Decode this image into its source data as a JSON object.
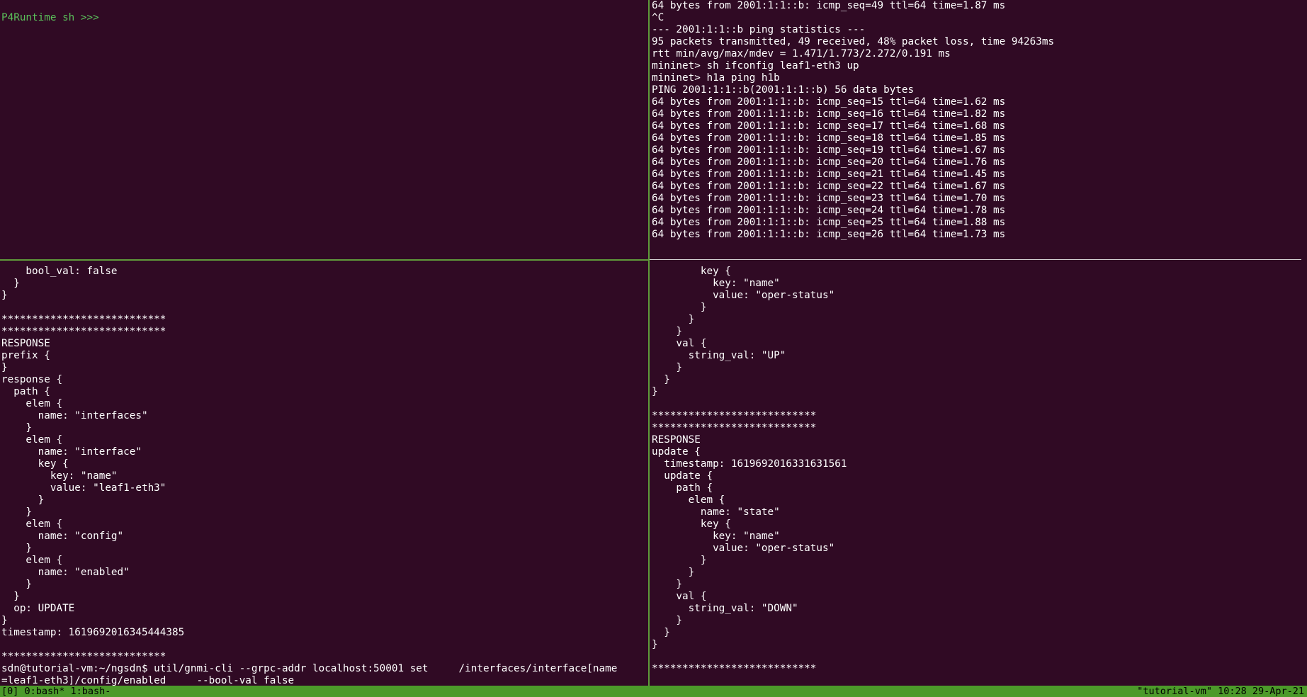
{
  "panes": {
    "top_left": {
      "prompt": "P4Runtime sh >>> "
    },
    "top_right": {
      "lines": [
        "64 bytes from 2001:1:1::b: icmp_seq=49 ttl=64 time=1.87 ms",
        "^C",
        "--- 2001:1:1::b ping statistics ---",
        "95 packets transmitted, 49 received, 48% packet loss, time 94263ms",
        "rtt min/avg/max/mdev = 1.471/1.773/2.272/0.191 ms",
        "mininet> sh ifconfig leaf1-eth3 up",
        "mininet> h1a ping h1b",
        "PING 2001:1:1::b(2001:1:1::b) 56 data bytes",
        "64 bytes from 2001:1:1::b: icmp_seq=15 ttl=64 time=1.62 ms",
        "64 bytes from 2001:1:1::b: icmp_seq=16 ttl=64 time=1.82 ms",
        "64 bytes from 2001:1:1::b: icmp_seq=17 ttl=64 time=1.68 ms",
        "64 bytes from 2001:1:1::b: icmp_seq=18 ttl=64 time=1.85 ms",
        "64 bytes from 2001:1:1::b: icmp_seq=19 ttl=64 time=1.67 ms",
        "64 bytes from 2001:1:1::b: icmp_seq=20 ttl=64 time=1.76 ms",
        "64 bytes from 2001:1:1::b: icmp_seq=21 ttl=64 time=1.45 ms",
        "64 bytes from 2001:1:1::b: icmp_seq=22 ttl=64 time=1.67 ms",
        "64 bytes from 2001:1:1::b: icmp_seq=23 ttl=64 time=1.70 ms",
        "64 bytes from 2001:1:1::b: icmp_seq=24 ttl=64 time=1.78 ms",
        "64 bytes from 2001:1:1::b: icmp_seq=25 ttl=64 time=1.88 ms",
        "64 bytes from 2001:1:1::b: icmp_seq=26 ttl=64 time=1.73 ms"
      ]
    },
    "bottom_left": {
      "lines": [
        "    bool_val: false",
        "  }",
        "}",
        "",
        "***************************",
        "***************************",
        "RESPONSE",
        "prefix {",
        "}",
        "response {",
        "  path {",
        "    elem {",
        "      name: \"interfaces\"",
        "    }",
        "    elem {",
        "      name: \"interface\"",
        "      key {",
        "        key: \"name\"",
        "        value: \"leaf1-eth3\"",
        "      }",
        "    }",
        "    elem {",
        "      name: \"config\"",
        "    }",
        "    elem {",
        "      name: \"enabled\"",
        "    }",
        "  }",
        "  op: UPDATE",
        "}",
        "timestamp: 1619692016345444385",
        "",
        "***************************",
        "sdn@tutorial-vm:~/ngsdn$ util/gnmi-cli --grpc-addr localhost:50001 set     /interfaces/interface[name",
        "=leaf1-eth3]/config/enabled     --bool-val false"
      ]
    },
    "bottom_right": {
      "lines": [
        "        key {",
        "          key: \"name\"",
        "          value: \"oper-status\"",
        "        }",
        "      }",
        "    }",
        "    val {",
        "      string_val: \"UP\"",
        "    }",
        "  }",
        "}",
        "",
        "***************************",
        "***************************",
        "RESPONSE",
        "update {",
        "  timestamp: 1619692016331631561",
        "  update {",
        "    path {",
        "      elem {",
        "        name: \"state\"",
        "        key {",
        "          key: \"name\"",
        "          value: \"oper-status\"",
        "        }",
        "      }",
        "    }",
        "    val {",
        "      string_val: \"DOWN\"",
        "    }",
        "  }",
        "}",
        "",
        "***************************"
      ]
    }
  },
  "status_bar": {
    "windows": "[0] 0:bash* 1:bash-",
    "host": "\"tutorial-vm\" 10:28 29-Apr-21"
  }
}
